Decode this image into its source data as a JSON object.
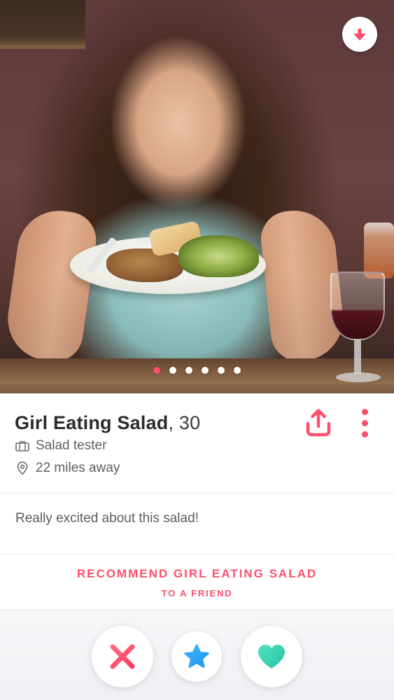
{
  "photo": {
    "alt_description": "",
    "carousel": {
      "total": 6,
      "active_index": 0
    }
  },
  "colors": {
    "accent": "#fd4f6d",
    "nope": "#fd4f6d",
    "super_like": "#2cabf5",
    "like": "#3ed5b4"
  },
  "profile": {
    "name": "Girl Eating Salad",
    "age_text": ", 30",
    "job": "Salad tester",
    "distance": "22 miles away",
    "bio": "Really excited about this salad!"
  },
  "recommend": {
    "line1": "RECOMMEND GIRL EATING SALAD",
    "line2": "TO A FRIEND"
  },
  "icons": {
    "close_profile": "arrow-down-icon",
    "share": "share-icon",
    "more": "more-vertical-icon",
    "job": "briefcase-icon",
    "distance": "location-pin-icon",
    "nope": "x-icon",
    "super_like": "star-icon",
    "like": "heart-icon"
  }
}
